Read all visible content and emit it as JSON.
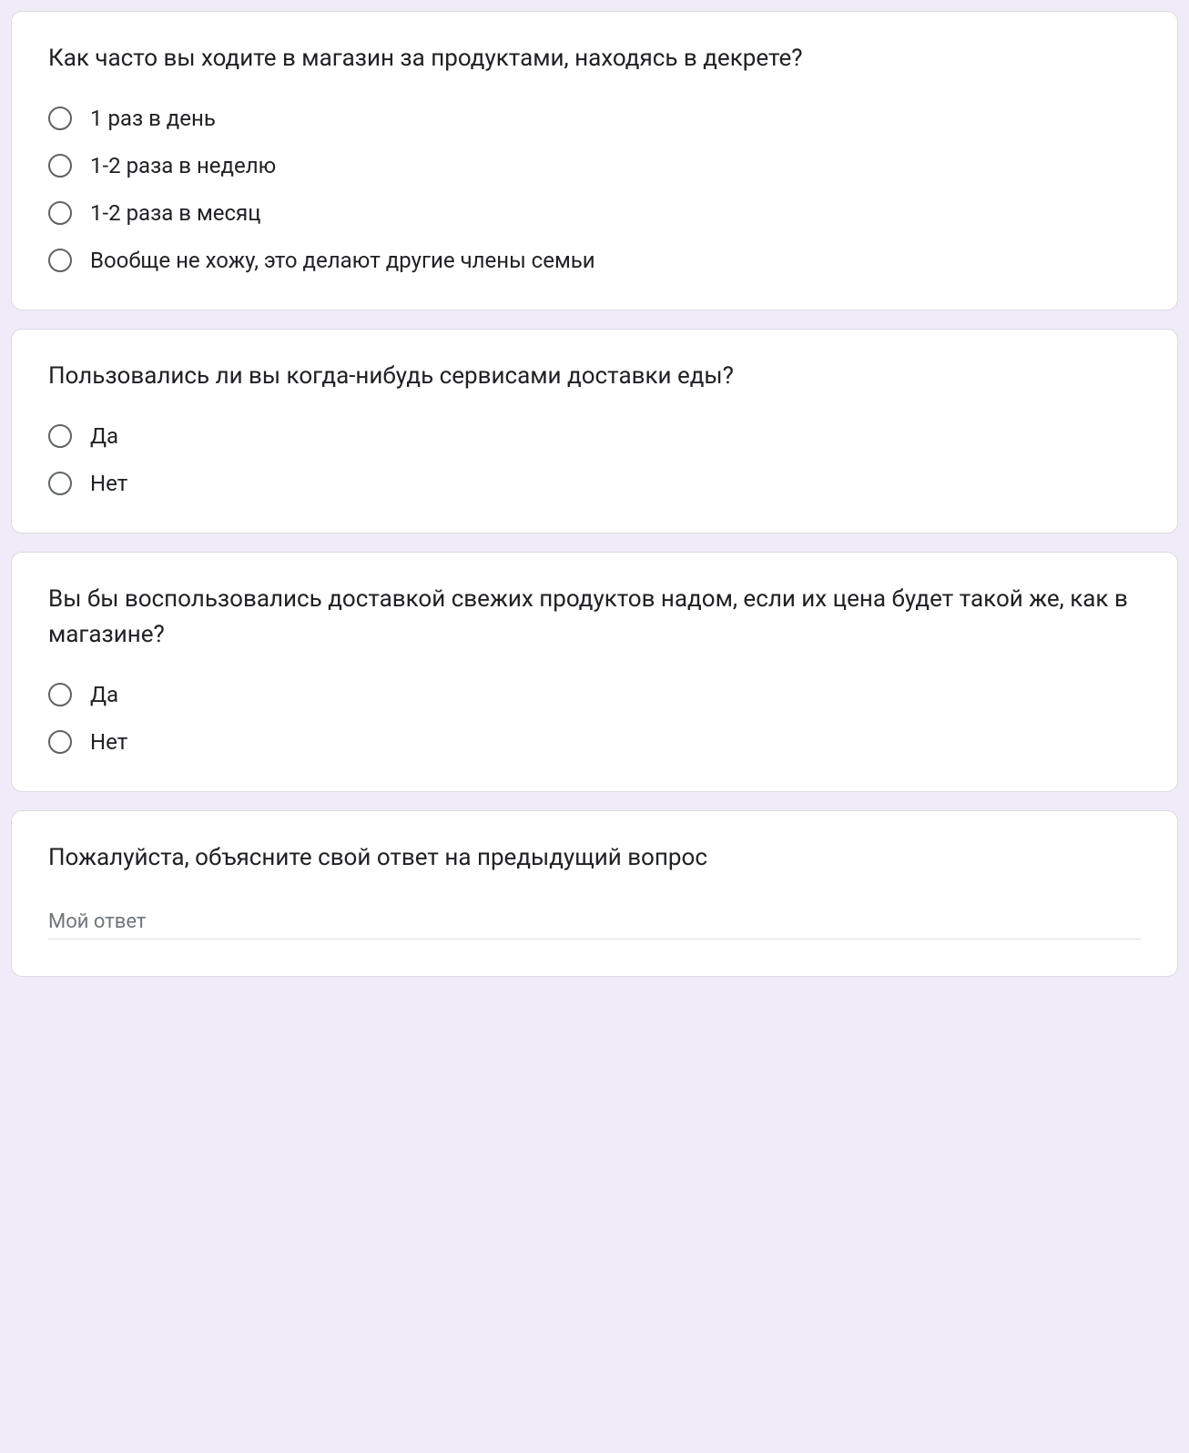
{
  "questions": [
    {
      "title": "Как часто вы ходите в магазин за продуктами, находясь в декрете?",
      "type": "radio",
      "options": [
        "1 раз в день",
        "1-2 раза в неделю",
        "1-2 раза в месяц",
        "Вообще не хожу, это делают другие члены семьи"
      ]
    },
    {
      "title": "Пользовались ли вы когда-нибудь сервисами доставки еды?",
      "type": "radio",
      "options": [
        "Да",
        "Нет"
      ]
    },
    {
      "title": "Вы бы воспользовались доставкой свежих продуктов надом, если их цена будет такой же, как в магазине?",
      "type": "radio",
      "options": [
        "Да",
        "Нет"
      ]
    },
    {
      "title": "Пожалуйста, объясните свой ответ на предыдущий вопрос",
      "type": "text",
      "placeholder": "Мой ответ"
    }
  ]
}
